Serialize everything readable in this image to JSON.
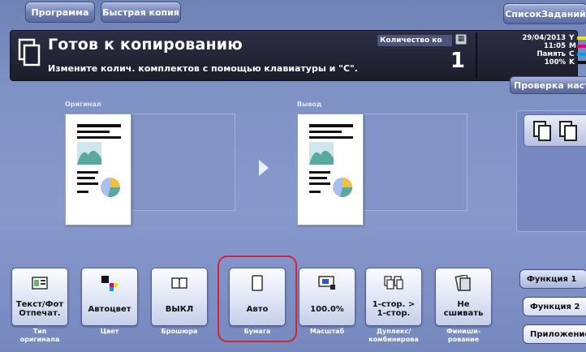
{
  "tabs": {
    "program": "Программа",
    "quick_copy": "Быстрая копия",
    "job_list": "СписокЗаданий"
  },
  "status": {
    "title": "Готов к копированию",
    "subtitle": "Измените колич. комплектов с помощью клавиатуры и \"С\".",
    "quantity_label": "Количество ко",
    "quantity_value": "1",
    "date": "29/04/2013",
    "time": "11:05",
    "memory_label": "Память",
    "memory_value": "100%",
    "toner": [
      {
        "letter": "Y",
        "color": "#f2e600"
      },
      {
        "letter": "M",
        "color": "#e4007f"
      },
      {
        "letter": "C",
        "color": "#00a0e9"
      },
      {
        "letter": "K",
        "color": "#111111"
      }
    ]
  },
  "check_settings": "Проверка настро",
  "preview": {
    "original_label": "Оригинал",
    "output_label": "Вывод"
  },
  "function_buttons": [
    {
      "value": "Текст/Фот\nОтпечат.",
      "caption": "Тип\nоригинала",
      "icon": "original-type-icon"
    },
    {
      "value": "Автоцвет",
      "caption": "Цвет",
      "icon": "color-icon"
    },
    {
      "value": "ВЫКЛ",
      "caption": "Брошюра",
      "icon": "booklet-icon"
    },
    {
      "value": "Авто",
      "caption": "Бумага",
      "icon": "paper-icon"
    },
    {
      "value": "100.0%",
      "caption": "Масштаб",
      "icon": "zoom-icon"
    },
    {
      "value": "1-стор. >\n1-стор.",
      "caption": "Дуплекс/\nкомбинирова",
      "icon": "duplex-icon"
    },
    {
      "value": "Не\nсшивать",
      "caption": "Финиши-\nрование",
      "icon": "finishing-icon"
    }
  ],
  "side_buttons": {
    "function1": "Функция 1",
    "function2": "Функция 2",
    "application": "Приложение"
  },
  "colors": {
    "highlight": "#d0253a",
    "background": "#8899cc"
  }
}
